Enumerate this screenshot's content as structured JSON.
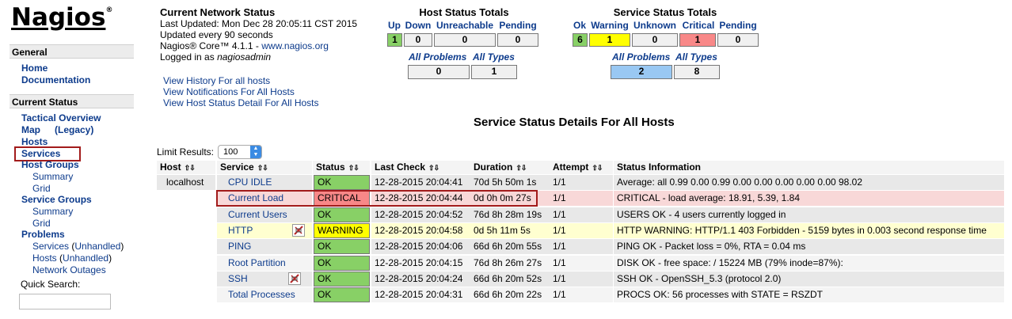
{
  "sidebar": {
    "logo": "Nagios",
    "logo_mark": "®",
    "general": {
      "heading": "General",
      "items": [
        "Home",
        "Documentation"
      ]
    },
    "current_status": {
      "heading": "Current Status",
      "tactical": "Tactical Overview",
      "map": "Map",
      "legacy": "(Legacy)",
      "hosts": "Hosts",
      "services": "Services",
      "host_groups": "Host Groups",
      "hg_summary": "Summary",
      "hg_grid": "Grid",
      "service_groups": "Service Groups",
      "sg_summary": "Summary",
      "sg_grid": "Grid",
      "problems": "Problems",
      "prob_services": "Services",
      "prob_services_unhandled": "Unhandled",
      "prob_hosts": "Hosts",
      "prob_hosts_unhandled": "Unhandled",
      "network_outages": "Network Outages",
      "open_paren": "(",
      "close_paren": ")"
    },
    "quick_search_label": "Quick Search:"
  },
  "info": {
    "title": "Current Network Status",
    "last_updated": "Last Updated: Mon Dec 28 20:05:11 CST 2015",
    "updated_every": "Updated every 90 seconds",
    "core_prefix": "Nagios® Core™ 4.1.1 - ",
    "core_link": "www.nagios.org",
    "logged_in_prefix": "Logged in as ",
    "logged_in_user": "nagiosadmin",
    "links": [
      "View History For all hosts",
      "View Notifications For All Hosts",
      "View Host Status Detail For All Hosts"
    ]
  },
  "host_totals": {
    "title": "Host Status Totals",
    "headers": [
      "Up",
      "Down",
      "Unreachable",
      "Pending"
    ],
    "values": [
      "1",
      "0",
      "0",
      "0"
    ],
    "all_problems_label": "All Problems",
    "all_types_label": "All Types",
    "all_problems": "0",
    "all_types": "1"
  },
  "service_totals": {
    "title": "Service Status Totals",
    "headers": [
      "Ok",
      "Warning",
      "Unknown",
      "Critical",
      "Pending"
    ],
    "values": [
      "6",
      "1",
      "0",
      "1",
      "0"
    ],
    "all_problems_label": "All Problems",
    "all_types_label": "All Types",
    "all_problems": "2",
    "all_types": "8"
  },
  "page_heading": "Service Status Details For All Hosts",
  "limit": {
    "label": "Limit Results:",
    "value": "100"
  },
  "table": {
    "headers": [
      "Host",
      "Service",
      "Status",
      "Last Check",
      "Duration",
      "Attempt",
      "Status Information"
    ],
    "sort_glyph": "⇧⇩",
    "rows": [
      {
        "host": "localhost",
        "service": "CPU IDLE",
        "status": "OK",
        "last_check": "12-28-2015 20:04:41",
        "duration": "70d 5h 50m 1s",
        "attempt": "1/1",
        "info": "Average: all 0.99 0.00 0.99 0.00 0.00 0.00 0.00 0.00 98.02"
      },
      {
        "host": "",
        "service": "Current Load",
        "status": "CRITICAL",
        "last_check": "12-28-2015 20:04:44",
        "duration": "0d 0h 0m 27s",
        "attempt": "1/1",
        "info": "CRITICAL - load average: 18.91, 5.39, 1.84"
      },
      {
        "host": "",
        "service": "Current Users",
        "status": "OK",
        "last_check": "12-28-2015 20:04:52",
        "duration": "76d 8h 28m 19s",
        "attempt": "1/1",
        "info": "USERS OK - 4 users currently logged in"
      },
      {
        "host": "",
        "service": "HTTP",
        "status": "WARNING",
        "last_check": "12-28-2015 20:04:58",
        "duration": "0d 5h 11m 5s",
        "attempt": "1/1",
        "info": "HTTP WARNING: HTTP/1.1 403 Forbidden - 5159 bytes in 0.003 second response time"
      },
      {
        "host": "",
        "service": "PING",
        "status": "OK",
        "last_check": "12-28-2015 20:04:06",
        "duration": "66d 6h 20m 55s",
        "attempt": "1/1",
        "info": "PING OK - Packet loss = 0%, RTA = 0.04 ms"
      },
      {
        "host": "",
        "service": "Root Partition",
        "status": "OK",
        "last_check": "12-28-2015 20:04:15",
        "duration": "76d 8h 26m 27s",
        "attempt": "1/1",
        "info": "DISK OK - free space: / 15224 MB (79% inode=87%):"
      },
      {
        "host": "",
        "service": "SSH",
        "status": "OK",
        "last_check": "12-28-2015 20:04:24",
        "duration": "66d 6h 20m 52s",
        "attempt": "1/1",
        "info": "SSH OK - OpenSSH_5.3 (protocol 2.0)"
      },
      {
        "host": "",
        "service": "Total Processes",
        "status": "OK",
        "last_check": "12-28-2015 20:04:31",
        "duration": "66d 6h 20m 22s",
        "attempt": "1/1",
        "info": "PROCS OK: 56 processes with STATE = RSZDT"
      }
    ]
  },
  "colors": {
    "ok": "#88d066",
    "warning": "#ffff00",
    "critical": "#f88888",
    "link": "#0d3b8c",
    "highlight": "#a21b1b"
  },
  "icons": {
    "flapping": "flapping-disabled-icon",
    "sort": "sort-arrows-icon",
    "select_arrow": "select-arrow-icon"
  }
}
